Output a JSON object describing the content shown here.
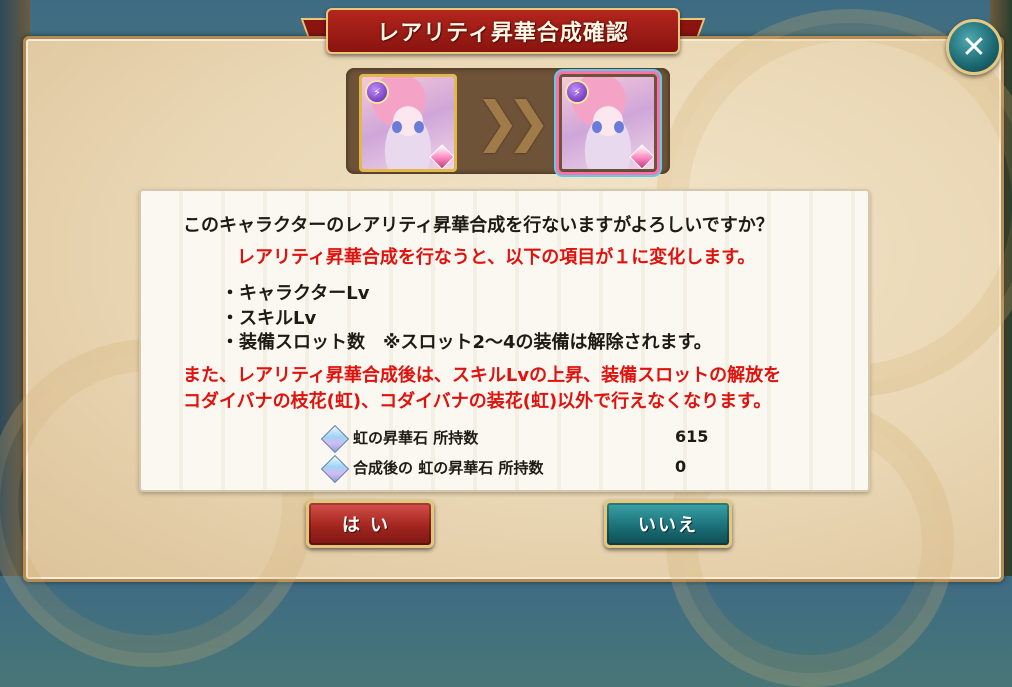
{
  "dialog": {
    "title": "レアリティ昇華合成確認",
    "close_icon_glyph": "✕"
  },
  "evolution": {
    "arrow_glyph": "❯❯",
    "attr_glyph": "⚡"
  },
  "message": {
    "question": "このキャラクターのレアリティ昇華合成を行ないますがよろしいですか？",
    "warning_reset": "レアリティ昇華合成を行なうと、以下の項目が１に変化します。",
    "items": [
      "・キャラクターLv",
      "・スキルLv",
      "・装備スロット数　※スロット2〜4の装備は解除されます。"
    ],
    "warning_lines": [
      "また、レアリティ昇華合成後は、スキルLvの上昇、装備スロットの解放を",
      "コダイバナの枝花(虹)、コダイバナの装花(虹)以外で行えなくなります。"
    ]
  },
  "stats": [
    {
      "label": "虹の昇華石 所持数",
      "value": "615"
    },
    {
      "label": "合成後の 虹の昇華石 所持数",
      "value": "0"
    }
  ],
  "buttons": {
    "yes_label": "はい",
    "no_label": "いいえ"
  },
  "colors": {
    "warning": "#e0120e",
    "title_ribbon": "#b3261e",
    "yes_button": "#a3261f",
    "no_button": "#1b7078"
  }
}
